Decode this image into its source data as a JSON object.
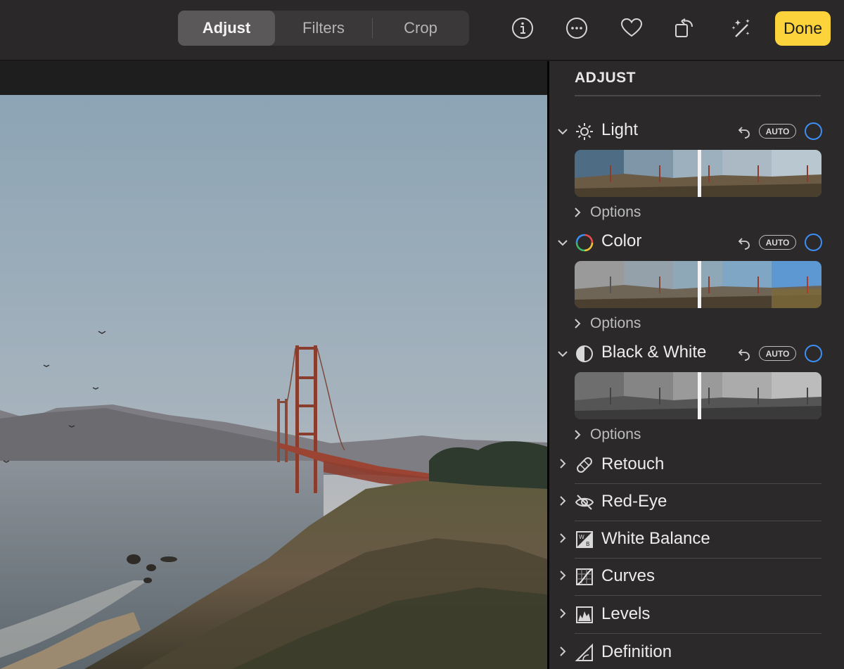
{
  "toolbar": {
    "tabs": [
      {
        "label": "Adjust",
        "active": true
      },
      {
        "label": "Filters",
        "active": false
      },
      {
        "label": "Crop",
        "active": false
      }
    ],
    "icons": [
      "info-icon",
      "more-icon",
      "heart-icon",
      "rotate-icon",
      "magic-wand-icon"
    ],
    "done_label": "Done"
  },
  "sidebar": {
    "title": "ADJUST",
    "auto_label": "AUTO",
    "options_label": "Options",
    "sections": [
      {
        "label": "Light",
        "icon": "sun-icon",
        "expanded": true
      },
      {
        "label": "Color",
        "icon": "color-wheel-icon",
        "expanded": true
      },
      {
        "label": "Black & White",
        "icon": "half-circle-icon",
        "expanded": true
      }
    ],
    "tools": [
      {
        "label": "Retouch",
        "icon": "bandage-icon"
      },
      {
        "label": "Red-Eye",
        "icon": "eye-icon"
      },
      {
        "label": "White Balance",
        "icon": "white-balance-icon",
        "glyph_w": "W",
        "glyph_b": "B"
      },
      {
        "label": "Curves",
        "icon": "curves-icon"
      },
      {
        "label": "Levels",
        "icon": "levels-icon"
      },
      {
        "label": "Definition",
        "icon": "definition-icon"
      }
    ]
  },
  "colors": {
    "accent_yellow": "#fcd33b",
    "toggle_blue": "#3d8ef5",
    "sidebar_bg": "#2b2929",
    "toolbar_bg": "#2a2828"
  }
}
